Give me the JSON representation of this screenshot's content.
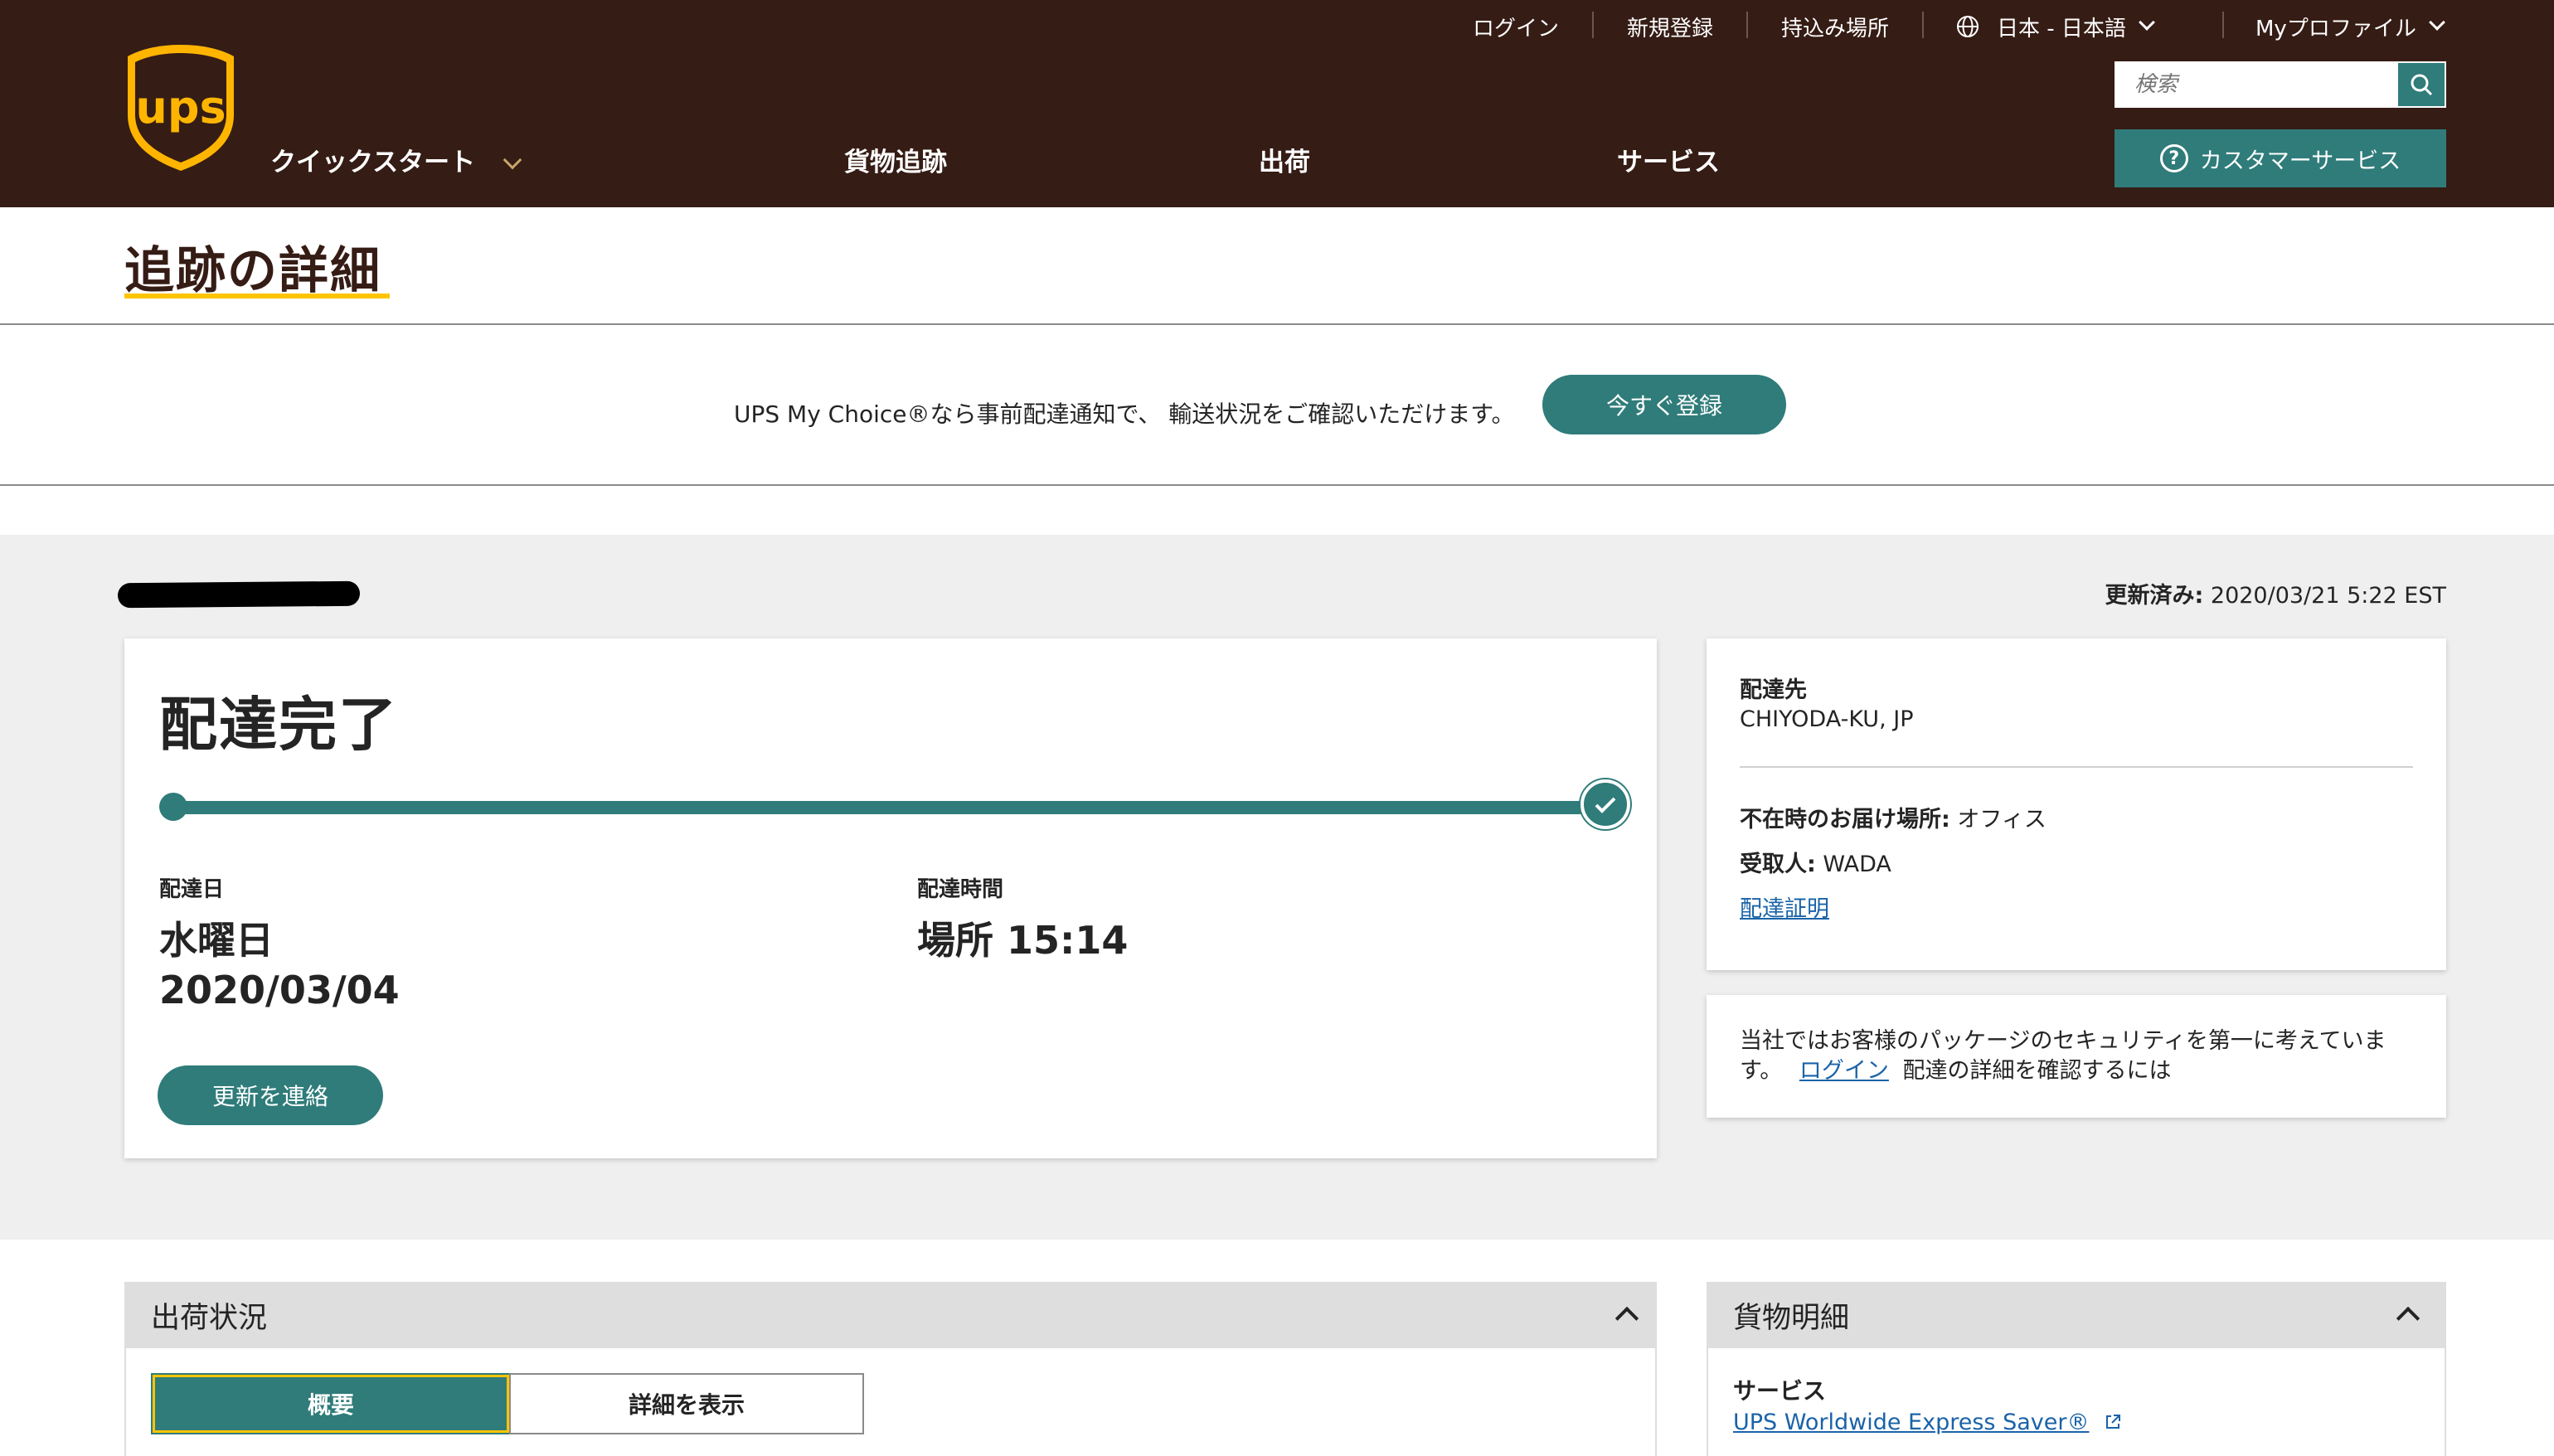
{
  "header": {
    "logo_text": "ups",
    "utility": {
      "login": "ログイン",
      "register": "新規登録",
      "dropoff": "持込み場所",
      "locale": "日本 - 日本語",
      "profile": "Myプロファイル"
    },
    "search_placeholder": "検索",
    "customer_service": "カスタマーサービス",
    "nav": {
      "quickstart": "クイックスタート",
      "tracking": "貨物追跡",
      "shipping": "出荷",
      "services": "サービス"
    }
  },
  "page_title": "追跡の詳細",
  "promo": {
    "text": "UPS My Choice®なら事前配達通知で、 輸送状況をご確認いただけます。",
    "button": "今すぐ登録"
  },
  "updated": {
    "label": "更新済み:",
    "value": "2020/03/21 5:22 EST"
  },
  "status": {
    "title": "配達完了",
    "progress": 1.0,
    "date_label": "配達日",
    "date_day": "水曜日",
    "date_value": "2020/03/04",
    "time_label": "配達時間",
    "time_value": "場所 15:14",
    "contact_button": "更新を連絡"
  },
  "destination": {
    "label": "配達先",
    "value": "CHIYODA-KU, JP",
    "leave_label": "不在時のお届け場所:",
    "leave_value": "オフィス",
    "receiver_label": "受取人:",
    "receiver_value": "WADA",
    "proof_link": "配達証明"
  },
  "security": {
    "text_a": "当社ではお客様のパッケージのセキュリティを第一に考えていま",
    "text_b": "す。",
    "login_link": "ログイン",
    "text_c": "配達の詳細を確認するには"
  },
  "shipment_panel": {
    "title": "出荷状況",
    "tab_summary": "概要",
    "tab_details": "詳細を表示"
  },
  "cargo_panel": {
    "title": "貨物明細",
    "service_label": "サービス",
    "service_value": "UPS Worldwide Express Saver®"
  },
  "colors": {
    "header_bg": "#351c15",
    "accent_teal": "#2f7c7a",
    "title_underline": "#ffc400",
    "link": "#1a63a8"
  }
}
